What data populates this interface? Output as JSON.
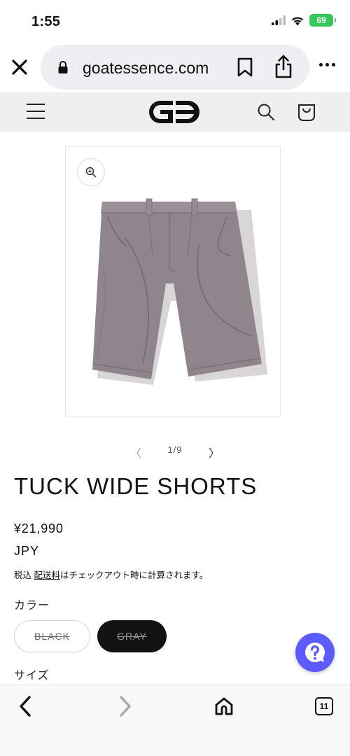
{
  "status_bar": {
    "time": "1:55",
    "battery_level": "69",
    "icons": [
      "cellular-signal-icon",
      "wifi-icon",
      "battery-charging-icon"
    ]
  },
  "browser": {
    "url": "goatessence.com",
    "close_icon": "close-icon",
    "lock_icon": "lock-icon",
    "bookmark_icon": "bookmark-icon",
    "share_icon": "share-icon",
    "more_icon": "more-icon"
  },
  "site_header": {
    "menu_icon": "hamburger-menu-icon",
    "logo_icon": "goat-essence-logo",
    "search_icon": "search-icon",
    "cart_icon": "cart-bag-icon"
  },
  "product": {
    "image_icon": "wide-shorts-product-image",
    "zoom_icon": "zoom-in-icon",
    "pagination": {
      "current": "1/9",
      "prev_icon": "chevron-left-icon",
      "next_icon": "chevron-right-icon"
    },
    "title": "TUCK WIDE SHORTS",
    "price": "¥21,990",
    "currency": "JPY",
    "tax_prefix": "税込 ",
    "shipping_link": "配送料",
    "tax_suffix": "はチェックアウト時に計算されます。",
    "color_label": "カラー",
    "variants": [
      {
        "label": "BLACK",
        "selected": false,
        "sold_out": true
      },
      {
        "label": "GRAY",
        "selected": true,
        "sold_out": true
      }
    ],
    "size_label": "サイズ"
  },
  "help": {
    "icon": "question-mark-chat-icon"
  },
  "toolbar": {
    "back_icon": "back-arrow-icon",
    "forward_icon": "forward-arrow-icon",
    "home_icon": "home-icon",
    "tab_count": "11"
  },
  "colors": {
    "header_bg": "#eeefef",
    "url_bar_bg": "#eeeff1",
    "selected_variant_bg": "#121212",
    "help_button": "#5b5bff",
    "battery": "#34c759",
    "shorts_fabric": "#8f868c"
  }
}
